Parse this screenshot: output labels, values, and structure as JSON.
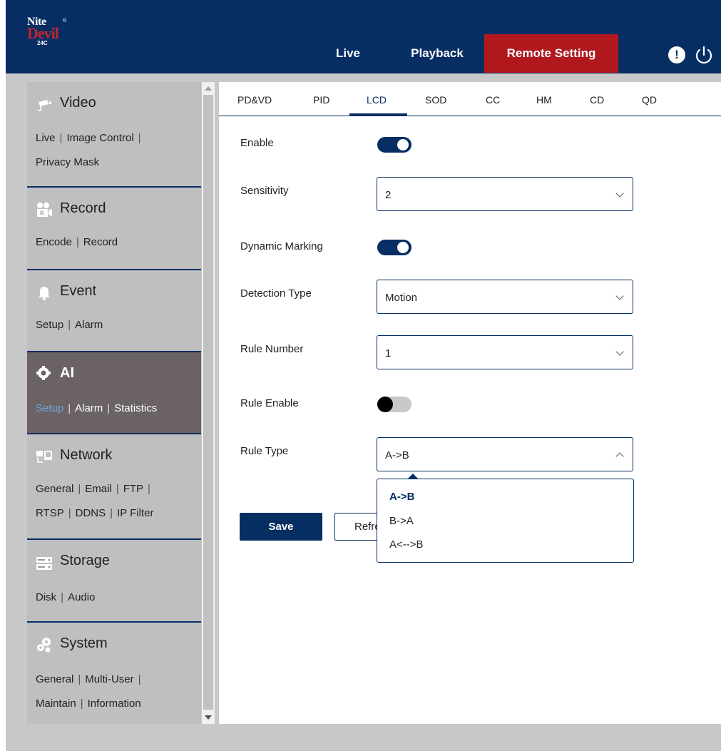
{
  "brand": {
    "line1": "Nite",
    "line2": "Devil",
    "line3": "24C",
    "reg": "®"
  },
  "nav": {
    "live": "Live",
    "playback": "Playback",
    "remote": "Remote Setting",
    "alert_glyph": "!"
  },
  "sidebar": {
    "video": {
      "title": "Video",
      "icon": "camera-icon",
      "links": [
        "Live",
        "Image Control",
        "Privacy Mask"
      ]
    },
    "record": {
      "title": "Record",
      "icon": "record-icon",
      "links": [
        "Encode",
        "Record"
      ]
    },
    "event": {
      "title": "Event",
      "icon": "bell-icon",
      "links": [
        "Setup",
        "Alarm"
      ]
    },
    "ai": {
      "title": "AI",
      "icon": "ai-gear-icon",
      "links": [
        "Setup",
        "Alarm",
        "Statistics"
      ],
      "current": "Setup"
    },
    "network": {
      "title": "Network",
      "icon": "network-icon",
      "links": [
        "General",
        "Email",
        "FTP",
        "RTSP",
        "DDNS",
        "IP Filter"
      ]
    },
    "storage": {
      "title": "Storage",
      "icon": "storage-icon",
      "links": [
        "Disk",
        "Audio"
      ]
    },
    "system": {
      "title": "System",
      "icon": "gears-icon",
      "links": [
        "General",
        "Multi-User",
        "Maintain",
        "Information"
      ]
    }
  },
  "tabs": [
    "PD&VD",
    "PID",
    "LCD",
    "SOD",
    "CC",
    "HM",
    "CD",
    "QD"
  ],
  "active_tab": "LCD",
  "form": {
    "enable": {
      "label": "Enable",
      "on": true
    },
    "sensitivity": {
      "label": "Sensitivity",
      "value": "2"
    },
    "dynamic_marking": {
      "label": "Dynamic Marking",
      "on": true
    },
    "detection_type": {
      "label": "Detection Type",
      "value": "Motion"
    },
    "rule_number": {
      "label": "Rule Number",
      "value": "1"
    },
    "rule_enable": {
      "label": "Rule Enable",
      "on": false
    },
    "rule_type": {
      "label": "Rule Type",
      "value": "A->B",
      "options": [
        "A->B",
        "B->A",
        "A<-->B"
      ]
    }
  },
  "buttons": {
    "save": "Save",
    "refresh": "Refresh"
  },
  "colors": {
    "navy": "#062e63",
    "red": "#b0181e",
    "sidebar": "#bfbfbf",
    "active_section": "#6b6363",
    "active_link": "#6ea4e4"
  }
}
